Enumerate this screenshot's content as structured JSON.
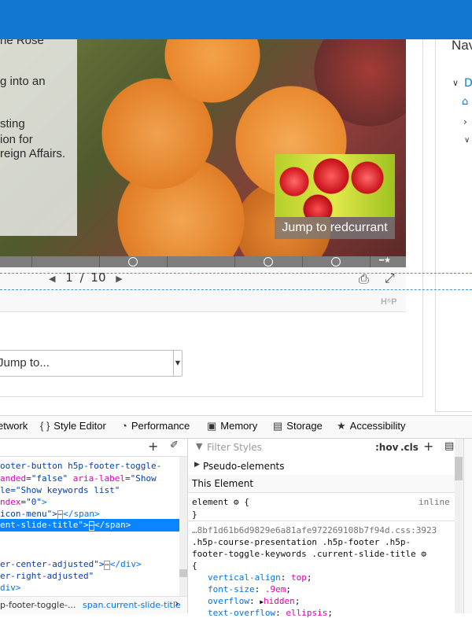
{
  "slide": {
    "text_lines": [
      "ne Rose",
      "g into an",
      "sting",
      "ion for",
      "reign Affairs."
    ],
    "thumbnail_label": "Jump to redcurrant",
    "pager": {
      "current": "1",
      "separator": "/",
      "total": "10"
    },
    "logo": "H⁵P",
    "nav_title": "Nav",
    "jump_select": "Jump to..."
  },
  "devtools": {
    "tabs": [
      {
        "label": "etwork",
        "icon": "network-icon"
      },
      {
        "label": "Style Editor",
        "icon": "braces-icon"
      },
      {
        "label": "Performance",
        "icon": "gauge-icon"
      },
      {
        "label": "Memory",
        "icon": "chip-icon"
      },
      {
        "label": "Storage",
        "icon": "storage-icon"
      },
      {
        "label": "Accessibility",
        "icon": "accessibility-icon"
      }
    ],
    "markup": {
      "line1_a": "ooter-button h5p-footer-toggle-",
      "line2_attr": "anded",
      "line2_val": "\"false\"",
      "line2_attr2": " aria-label",
      "line2_val2": "\"Show",
      "line3_val": "le=\"Show keywords list\"",
      "line4_attr": "ndex",
      "line4_val": "\"0\"",
      "line5_a": "icon-menu\">",
      "line5_b": "</span>",
      "line6_selected": "ent-slide-title\">",
      "line6_end": "</span>",
      "line7_a": "er-center-adjusted\">",
      "line7_b": "</div>",
      "line8_a": "er-right-adjusted\"",
      "line9_a": "div>"
    },
    "breadcrumb": {
      "item1": "p-footer-toggle-...",
      "item2": "span.current-slide-title"
    },
    "rules": {
      "filter_placeholder": "Filter Styles",
      "hov": ":hov",
      "cls": ".cls",
      "pseudo_elements": "Pseudo-elements",
      "this_element": "This Element",
      "element_selector": "element",
      "element_source": "inline",
      "source_file": "…8bf1d61b6d9829e6a81afe972269108b7f94d.css:3923",
      "selector_line1": ".h5p-course-presentation .h5p-footer .h5p-",
      "selector_line2": "footer-toggle-keywords .current-slide-title",
      "decls": [
        {
          "prop": "vertical-align",
          "value": "top"
        },
        {
          "prop": "font-size",
          "value": ".9em"
        },
        {
          "prop": "overflow",
          "value": "hidden"
        },
        {
          "prop": "text-overflow",
          "value": "ellipsis"
        }
      ]
    }
  }
}
